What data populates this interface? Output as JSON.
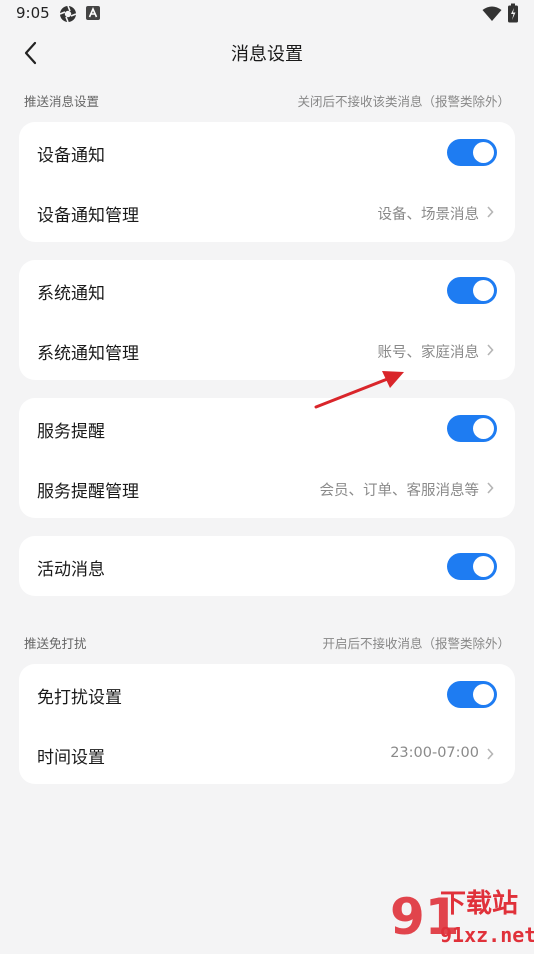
{
  "status_bar": {
    "time": "9:05",
    "icons": [
      "aperture-icon",
      "a-badge-icon",
      "wifi-icon",
      "battery-icon"
    ]
  },
  "header": {
    "title": "消息设置",
    "back_icon": "chevron-left-icon"
  },
  "sections": {
    "push": {
      "title": "推送消息设置",
      "note": "关闭后不接收该类消息（报警类除外）"
    },
    "dnd": {
      "title": "推送免打扰",
      "note": "开启后不接收消息（报警类除外）"
    }
  },
  "cards": {
    "device": {
      "toggle_label": "设备通知",
      "toggle_on": true,
      "manage_label": "设备通知管理",
      "manage_value": "设备、场景消息"
    },
    "system": {
      "toggle_label": "系统通知",
      "toggle_on": true,
      "manage_label": "系统通知管理",
      "manage_value": "账号、家庭消息"
    },
    "service": {
      "toggle_label": "服务提醒",
      "toggle_on": true,
      "manage_label": "服务提醒管理",
      "manage_value": "会员、订单、客服消息等"
    },
    "activity": {
      "toggle_label": "活动消息",
      "toggle_on": true
    },
    "dnd": {
      "toggle_label": "免打扰设置",
      "toggle_on": true,
      "time_label": "时间设置",
      "time_value": "23:00-07:00"
    }
  },
  "colors": {
    "toggle_on": "#1e7cf2",
    "background": "#f4f4f5",
    "card": "#ffffff",
    "annotation_arrow": "#d9252a",
    "watermark": "#e0313a"
  },
  "watermark": {
    "brand_text": "下载站",
    "domain_text": "91xz.net"
  }
}
